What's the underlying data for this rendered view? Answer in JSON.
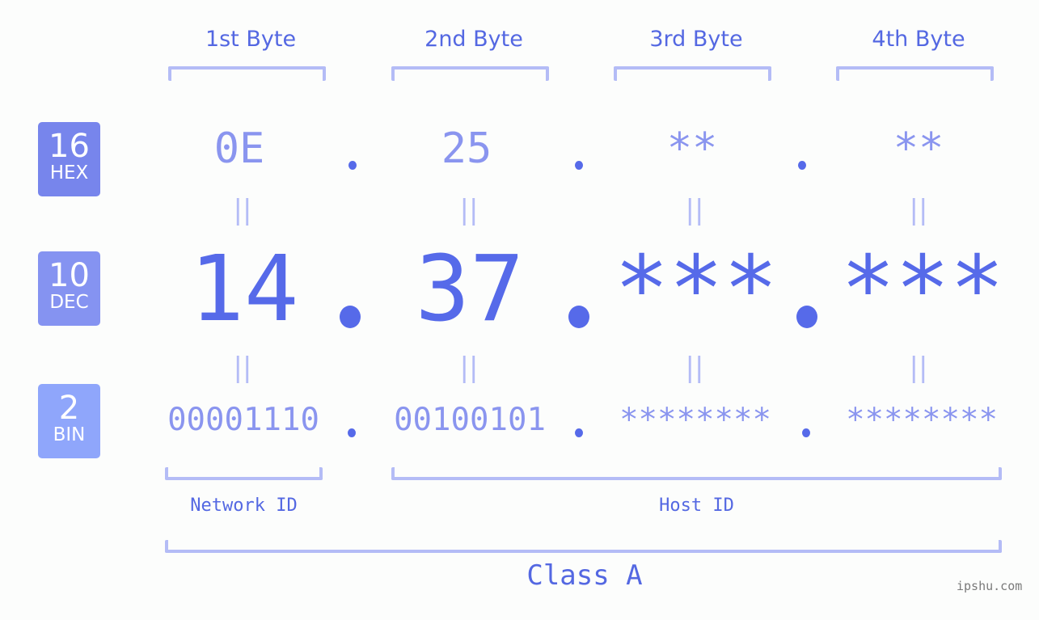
{
  "byte_headers": [
    "1st Byte",
    "2nd Byte",
    "3rd Byte",
    "4th Byte"
  ],
  "badges": {
    "hex": {
      "number": "16",
      "label": "HEX",
      "color": "#7785ec"
    },
    "dec": {
      "number": "10",
      "label": "DEC",
      "color": "#8593f1"
    },
    "bin": {
      "number": "2",
      "label": "BIN",
      "color": "#8fa6fb"
    }
  },
  "hex": [
    "0E",
    "25",
    "**",
    "**"
  ],
  "dec": [
    "14",
    "37",
    "***",
    "***"
  ],
  "bin": [
    "00001110",
    "00100101",
    "********",
    "********"
  ],
  "equals_symbol": "||",
  "labels": {
    "network_id": "Network ID",
    "host_id": "Host ID",
    "class": "Class A"
  },
  "watermark": "ipshu.com",
  "colors": {
    "accent": "#566ae9",
    "light_accent": "#8a95ef",
    "bracket": "#b4bcf6",
    "background": "#fcfdfc"
  }
}
